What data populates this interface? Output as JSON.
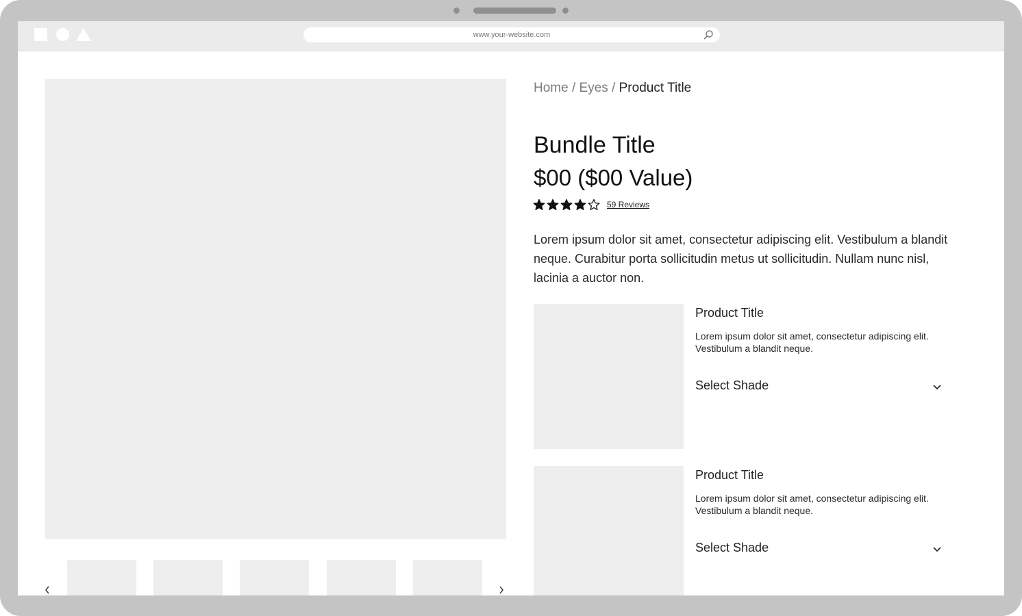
{
  "browser": {
    "url": "www.your-website.com"
  },
  "breadcrumb": {
    "home": "Home",
    "separator1": " / ",
    "category": "Eyes",
    "separator2": " / ",
    "current": "Product Title"
  },
  "product": {
    "title": "Bundle Title",
    "price": "$00 ($00 Value)",
    "rating": 4,
    "rating_max": 5,
    "reviews_label": "59 Reviews",
    "description": "Lorem ipsum dolor sit amet, consectetur adipiscing elit. Vestibulum a blandit neque. Curabitur porta sollicitudin metus ut sollicitudin. Nullam nunc nisl, lacinia a auctor non."
  },
  "bundle_items": [
    {
      "title": "Product Title",
      "description": "Lorem ipsum dolor sit amet, consectetur adipiscing elit. Vestibulum a blandit neque.",
      "select_label": "Select Shade"
    },
    {
      "title": "Product Title",
      "description": "Lorem ipsum dolor sit amet, consectetur adipiscing elit. Vestibulum a blandit neque.",
      "select_label": "Select Shade"
    }
  ],
  "gallery": {
    "prev_icon": "chevron-left-icon",
    "next_icon": "chevron-right-icon"
  }
}
